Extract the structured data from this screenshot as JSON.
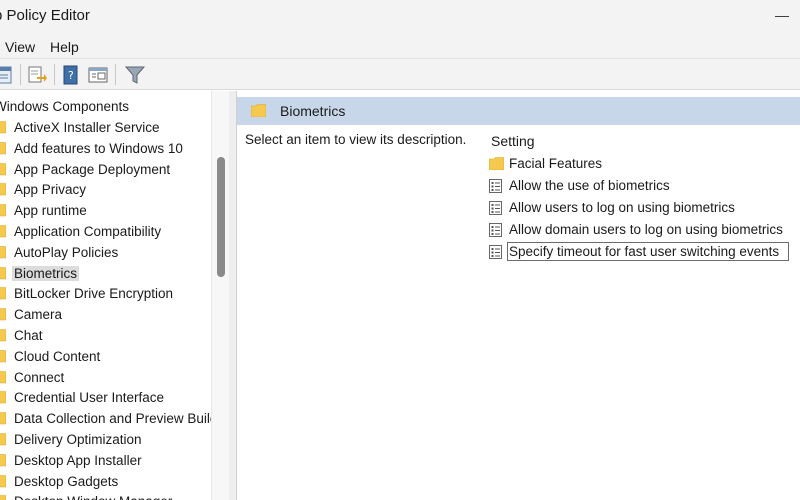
{
  "window": {
    "title": "p Policy Editor",
    "minimize_glyph": "—"
  },
  "menu": {
    "items": [
      "View",
      "Help"
    ]
  },
  "toolbar": {
    "buttons": [
      "back-icon",
      "export-icon",
      "help-book-icon",
      "properties-icon",
      "filter-icon"
    ]
  },
  "tree": {
    "root": "Windows Components",
    "items": [
      "ActiveX Installer Service",
      "Add features to Windows 10",
      "App Package Deployment",
      "App Privacy",
      "App runtime",
      "Application Compatibility",
      "AutoPlay Policies",
      "Biometrics",
      "BitLocker Drive Encryption",
      "Camera",
      "Chat",
      "Cloud Content",
      "Connect",
      "Credential User Interface",
      "Data Collection and Preview Builds",
      "Delivery Optimization",
      "Desktop App Installer",
      "Desktop Gadgets",
      "Desktop Window Manager"
    ],
    "selected_index": 7
  },
  "details": {
    "header": "Biometrics",
    "description": "Select an item to view its description.",
    "column_header": "Setting",
    "settings": [
      {
        "label": "Facial Features",
        "icon": "folder-icon"
      },
      {
        "label": "Allow the use of biometrics",
        "icon": "policy-setting-icon"
      },
      {
        "label": "Allow users to log on using biometrics",
        "icon": "policy-setting-icon"
      },
      {
        "label": "Allow domain users to log on using biometrics",
        "icon": "policy-setting-icon"
      },
      {
        "label": "Specify timeout for fast user switching events",
        "icon": "policy-setting-icon"
      }
    ]
  },
  "colors": {
    "header_bg": "#c7d7e9",
    "folder": "#f4c94d",
    "selection": "#dcdcdc"
  }
}
